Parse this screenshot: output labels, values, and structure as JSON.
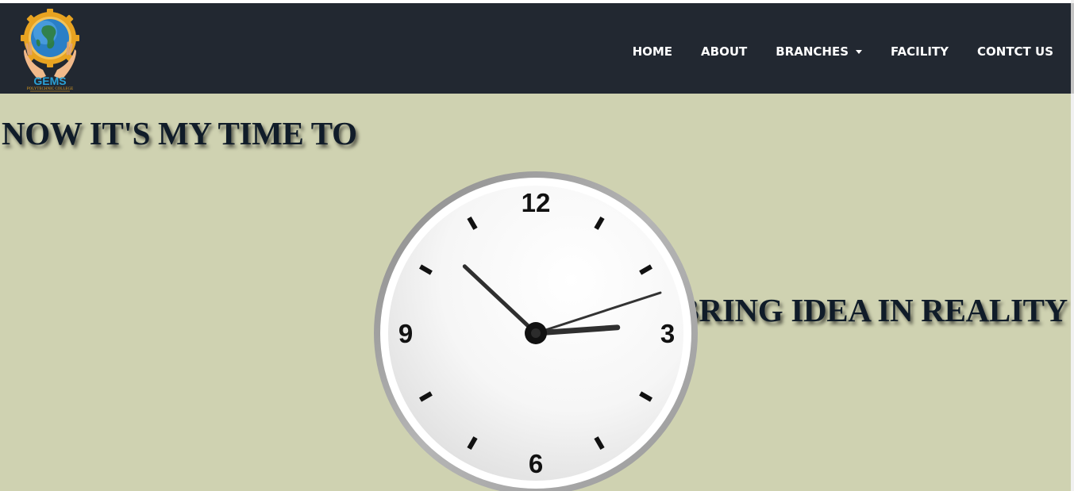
{
  "brand": {
    "logo_text": "GEMS",
    "logo_subtext": "POLYTECHNIC COLLEGE"
  },
  "nav": {
    "items": [
      {
        "label": "HOME"
      },
      {
        "label": "ABOUT"
      },
      {
        "label": "BRANCHES",
        "has_dropdown": true
      },
      {
        "label": "FACILITY"
      },
      {
        "label": "CONTCT US"
      }
    ]
  },
  "hero": {
    "headline_left": "NOW IT'S MY TIME TO",
    "headline_right": "BRING IDEA IN REALITY",
    "clock": {
      "numerals": [
        "12",
        "3",
        "6",
        "9"
      ],
      "time": {
        "hours": 2,
        "minutes": 52,
        "seconds": 12
      }
    }
  },
  "colors": {
    "navbar_bg": "#222831",
    "hero_bg": "#cfd2b1",
    "headline_text": "#101c29",
    "nav_text": "#ffffff"
  }
}
